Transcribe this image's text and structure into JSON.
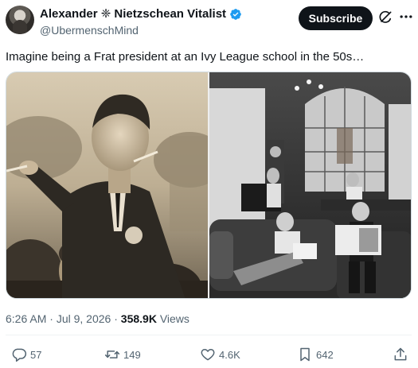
{
  "author": {
    "display_name": "Alexander ❈ Nietzschean Vitalist",
    "handle": "@UbermenschMind",
    "verified": true
  },
  "header": {
    "subscribe_label": "Subscribe",
    "icons": [
      "grok-icon",
      "more-icon"
    ]
  },
  "tweet": {
    "text": "Imagine being a Frat president at an Ivy League school in the 50s…"
  },
  "media": {
    "images": [
      {
        "description_icon": "photo",
        "alt": ""
      },
      {
        "description_icon": "photo",
        "alt": ""
      }
    ]
  },
  "meta": {
    "time": "6:26 AM",
    "date": "Jul 9, 2026",
    "views_count": "358.9K",
    "views_label": "Views",
    "sep": "·"
  },
  "actions": {
    "replies": "57",
    "reposts": "149",
    "likes": "4.6K",
    "bookmarks": "642"
  },
  "colors": {
    "accent_blue": "#1d9bf0",
    "text_primary": "#0f1419",
    "text_secondary": "#536471"
  }
}
